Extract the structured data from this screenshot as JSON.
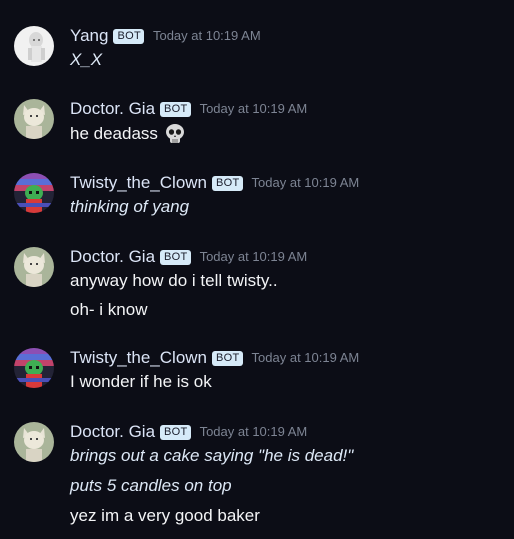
{
  "messages": [
    {
      "username": "Yang",
      "bot_label": "BOT",
      "timestamp": "Today at 10:19 AM",
      "avatar": "yang-avatar",
      "lines": [
        {
          "text": "X_X",
          "italic": true
        }
      ]
    },
    {
      "username": "Doctor. Gia",
      "bot_label": "BOT",
      "timestamp": "Today at 10:19 AM",
      "avatar": "gia-avatar",
      "lines": [
        {
          "text": "he deadass",
          "italic": false,
          "emoji": "skull-icon"
        }
      ]
    },
    {
      "username": "Twisty_the_Clown",
      "bot_label": "BOT",
      "timestamp": "Today at 10:19 AM",
      "avatar": "twisty-avatar",
      "lines": [
        {
          "text": "thinking of yang",
          "italic": true
        }
      ]
    },
    {
      "username": "Doctor. Gia",
      "bot_label": "BOT",
      "timestamp": "Today at 10:19 AM",
      "avatar": "gia-avatar",
      "lines": [
        {
          "text": "anyway how do i tell twisty..",
          "italic": false
        },
        {
          "text": "oh- i know",
          "italic": false
        }
      ]
    },
    {
      "username": "Twisty_the_Clown",
      "bot_label": "BOT",
      "timestamp": "Today at 10:19 AM",
      "avatar": "twisty-avatar",
      "lines": [
        {
          "text": "I wonder if he is ok",
          "italic": false
        }
      ]
    },
    {
      "username": "Doctor. Gia",
      "bot_label": "BOT",
      "timestamp": "Today at 10:19 AM",
      "avatar": "gia-avatar",
      "lines": [
        {
          "text": "brings out a cake saying \"he is dead!\"",
          "italic": true
        },
        {
          "text": "puts 5 candles on top",
          "italic": true
        },
        {
          "text": "yez im a very good baker",
          "italic": false
        }
      ]
    }
  ]
}
